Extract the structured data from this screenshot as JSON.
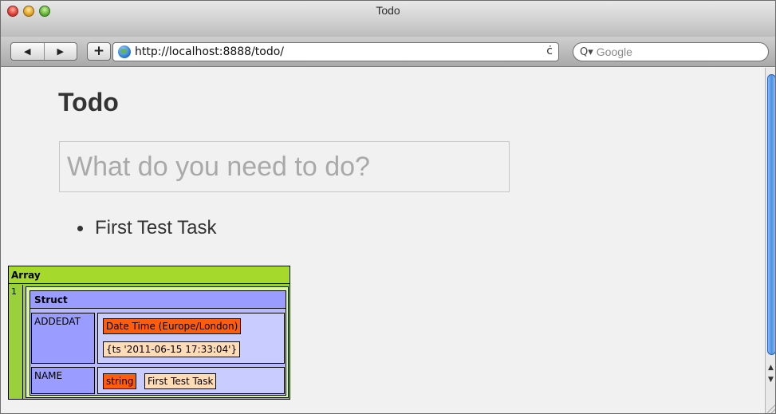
{
  "window": {
    "title": "Todo"
  },
  "toolbar": {
    "back_icon": "◀",
    "forward_icon": "▶",
    "add_icon": "+",
    "url": "http://localhost:8888/todo/",
    "reload_icon": "ċ",
    "search_icon": "Q▾",
    "search_placeholder": "Google"
  },
  "page": {
    "title": "Todo",
    "input_placeholder": "What do you need to do?",
    "tasks": [
      {
        "label": "First Test Task"
      }
    ]
  },
  "dump": {
    "array_label": "Array",
    "index": "1",
    "struct_label": "Struct",
    "fields": {
      "addedat": {
        "key": "ADDEDAT",
        "type": "Date Time (Europe/London)",
        "value": "{ts '2011-06-15 17:33:04'}"
      },
      "name": {
        "key": "NAME",
        "type": "string",
        "value": "First Test Task"
      }
    }
  },
  "colors": {
    "array_bg": "#9ad13a",
    "struct_bg": "#b7b8ff",
    "type_chip": "#ff5d0c",
    "value_chip": "#ffdcb8",
    "scroll_thumb": "#4a8fe6"
  }
}
